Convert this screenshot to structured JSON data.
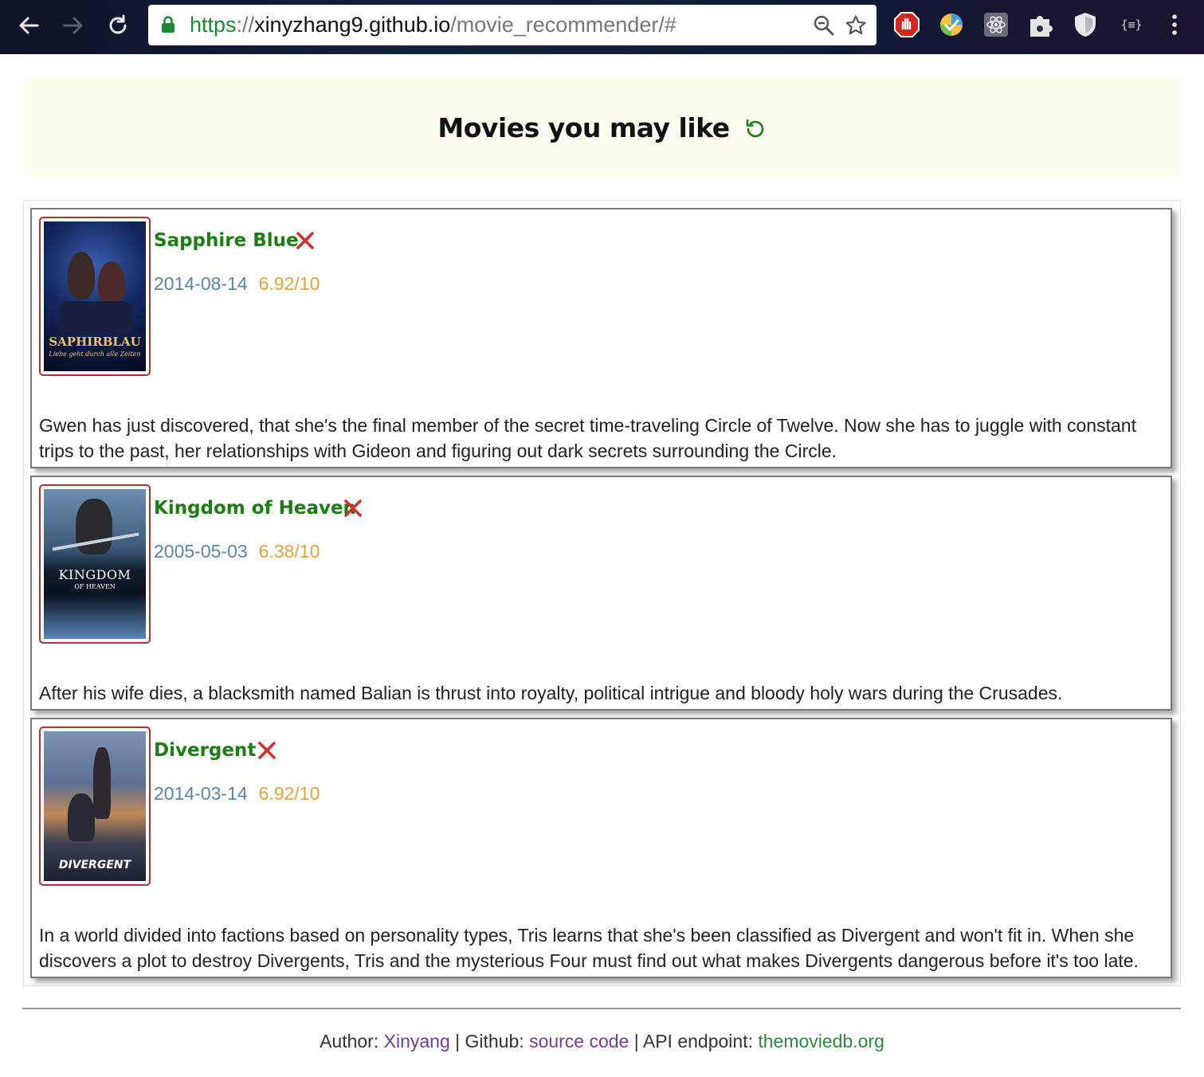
{
  "browser": {
    "url_scheme": "https",
    "url_sep": "://",
    "url_host": "xinyzhang9.github.io",
    "url_path": "/movie_recommender/#",
    "icons": [
      "back-icon",
      "forward-icon",
      "reload-icon",
      "lock-icon",
      "zoom-icon",
      "star-icon",
      "adblock-icon",
      "extension-color-icon",
      "react-devtools-icon",
      "extension-puzzle-icon",
      "shield-icon",
      "json-viewer-icon",
      "menu-icon"
    ],
    "json_ext_label": "{≡}"
  },
  "header": {
    "title": "Movies you may like",
    "refresh_icon": "refresh-icon"
  },
  "movies": [
    {
      "title": "Sapphire Blue",
      "date": "2014-08-14",
      "rating": "6.92/10",
      "overview": "Gwen has just discovered, that she's the final member of the secret time-traveling Circle of Twelve. Now she has to juggle with constant trips to the past, her relationships with Gideon and figuring out dark secrets surrounding the Circle.",
      "poster_text": "SAPHIRBLAU",
      "poster_subtext": "Liebe geht durch alle Zeiten"
    },
    {
      "title": "Kingdom of Heaven",
      "date": "2005-05-03",
      "rating": "6.38/10",
      "overview": "After his wife dies, a blacksmith named Balian is thrust into royalty, political intrigue and bloody holy wars during the Crusades.",
      "poster_text": "KINGDOM",
      "poster_subtext": "OF HEAVEN"
    },
    {
      "title": "Divergent",
      "date": "2014-03-14",
      "rating": "6.92/10",
      "overview": "In a world divided into factions based on personality types, Tris learns that she's been classified as Divergent and won't fit in. When she discovers a plot to destroy Divergents, Tris and the mysterious Four must find out what makes Divergents dangerous before it's too late.",
      "poster_text": "DIVERGENT",
      "poster_subtext": ""
    }
  ],
  "footer": {
    "author_label": "Author: ",
    "author_link": "Xinyang",
    "github_label": " | Github: ",
    "github_link": "source code",
    "api_label": " | API endpoint: ",
    "api_link": "themoviedb.org"
  },
  "colors": {
    "title_green": "#1c7d12",
    "date_blue": "#5b86a6",
    "rating_orange": "#e8a33a",
    "remove_red": "#d32f2f",
    "header_bg": "#fffcf2"
  }
}
